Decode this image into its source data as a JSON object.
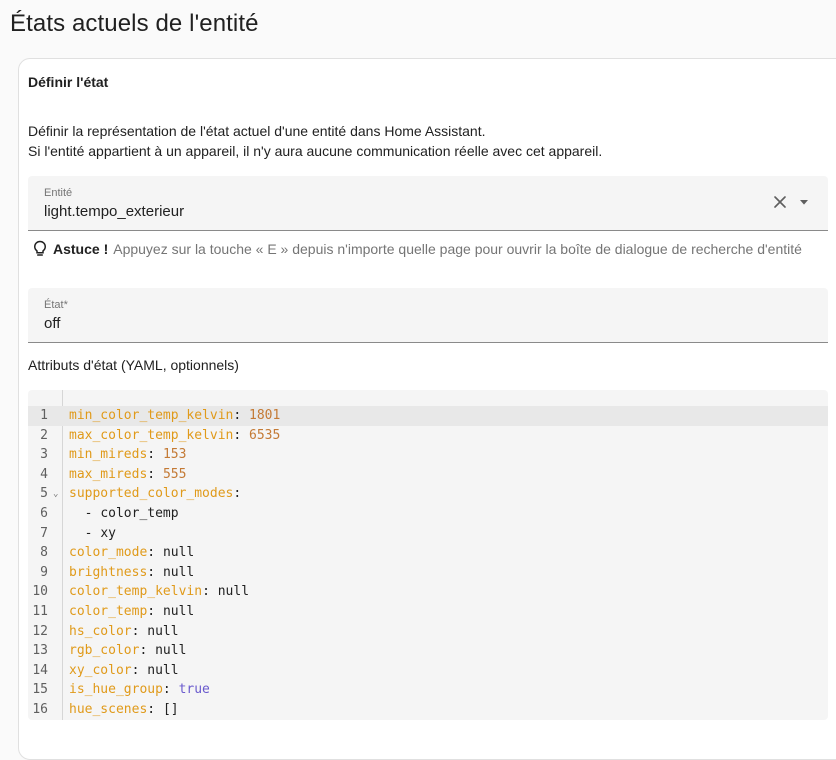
{
  "page": {
    "title": "États actuels de l'entité"
  },
  "card": {
    "header": "Définir l'état",
    "description_line1": "Définir la représentation de l'état actuel d'une entité dans Home Assistant.",
    "description_line2": "Si l'entité appartient à un appareil, il n'y aura aucune communication réelle avec cet appareil."
  },
  "entity_field": {
    "label": "Entité",
    "value": "light.tempo_exterieur"
  },
  "tip": {
    "bold": "Astuce !",
    "text": "Appuyez sur la touche « E » depuis n'importe quelle page pour ouvrir la boîte de dialogue de recherche d'entité"
  },
  "state_field": {
    "label": "État*",
    "value": "off"
  },
  "attributes": {
    "label": "Attributs d'état (YAML, optionnels)",
    "lines": [
      {
        "num": "1",
        "key": "min_color_temp_kelvin",
        "sep": ": ",
        "val": "1801",
        "type": "number"
      },
      {
        "num": "2",
        "key": "max_color_temp_kelvin",
        "sep": ": ",
        "val": "6535",
        "type": "number"
      },
      {
        "num": "3",
        "key": "min_mireds",
        "sep": ": ",
        "val": "153",
        "type": "number"
      },
      {
        "num": "4",
        "key": "max_mireds",
        "sep": ": ",
        "val": "555",
        "type": "number"
      },
      {
        "num": "5",
        "key": "supported_color_modes",
        "sep": ":",
        "val": "",
        "type": "plain",
        "fold": "⌄"
      },
      {
        "num": "6",
        "key": "",
        "sep": "  - ",
        "val": "color_temp",
        "type": "plain"
      },
      {
        "num": "7",
        "key": "",
        "sep": "  - ",
        "val": "xy",
        "type": "plain"
      },
      {
        "num": "8",
        "key": "color_mode",
        "sep": ": ",
        "val": "null",
        "type": "plain"
      },
      {
        "num": "9",
        "key": "brightness",
        "sep": ": ",
        "val": "null",
        "type": "plain"
      },
      {
        "num": "10",
        "key": "color_temp_kelvin",
        "sep": ": ",
        "val": "null",
        "type": "plain"
      },
      {
        "num": "11",
        "key": "color_temp",
        "sep": ": ",
        "val": "null",
        "type": "plain"
      },
      {
        "num": "12",
        "key": "hs_color",
        "sep": ": ",
        "val": "null",
        "type": "plain"
      },
      {
        "num": "13",
        "key": "rgb_color",
        "sep": ": ",
        "val": "null",
        "type": "plain"
      },
      {
        "num": "14",
        "key": "xy_color",
        "sep": ": ",
        "val": "null",
        "type": "plain"
      },
      {
        "num": "15",
        "key": "is_hue_group",
        "sep": ": ",
        "val": "true",
        "type": "bool"
      },
      {
        "num": "16",
        "key": "hue_scenes",
        "sep": ": ",
        "val": "[]",
        "type": "plain"
      }
    ]
  },
  "colors": {
    "yaml_key": "#e09a1a",
    "yaml_number": "#c47a35",
    "yaml_bool": "#6a5acd"
  },
  "icons": {
    "clear": "close-icon",
    "dropdown": "menu-down-icon",
    "tip": "lightbulb-outline-icon"
  }
}
